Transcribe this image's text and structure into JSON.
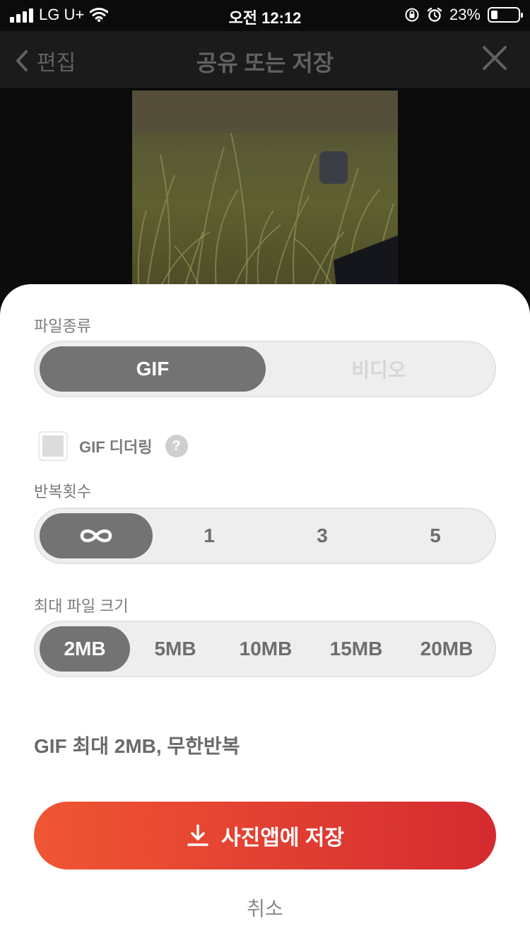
{
  "status_bar": {
    "carrier": "LG U+",
    "time": "오전 12:12",
    "battery": "23%"
  },
  "nav": {
    "back_label": "편집",
    "title": "공유 또는 저장"
  },
  "file_type": {
    "label": "파일종류",
    "options": [
      "GIF",
      "비디오"
    ],
    "selected": "GIF"
  },
  "dither": {
    "label": "GIF 디더링",
    "checked": false,
    "help": "?"
  },
  "loop": {
    "label": "반복횟수",
    "options": [
      "∞",
      "1",
      "3",
      "5"
    ],
    "selected": "∞"
  },
  "max_size": {
    "label": "최대 파일 크기",
    "options": [
      "2MB",
      "5MB",
      "10MB",
      "15MB",
      "20MB"
    ],
    "selected": "2MB"
  },
  "summary": "GIF 최대 2MB, 무한반복",
  "save_button": "사진앱에 저장",
  "cancel": "취소",
  "colors": {
    "accent_start": "#f05633",
    "accent_end": "#d42b30",
    "selected_segment": "#737373"
  }
}
